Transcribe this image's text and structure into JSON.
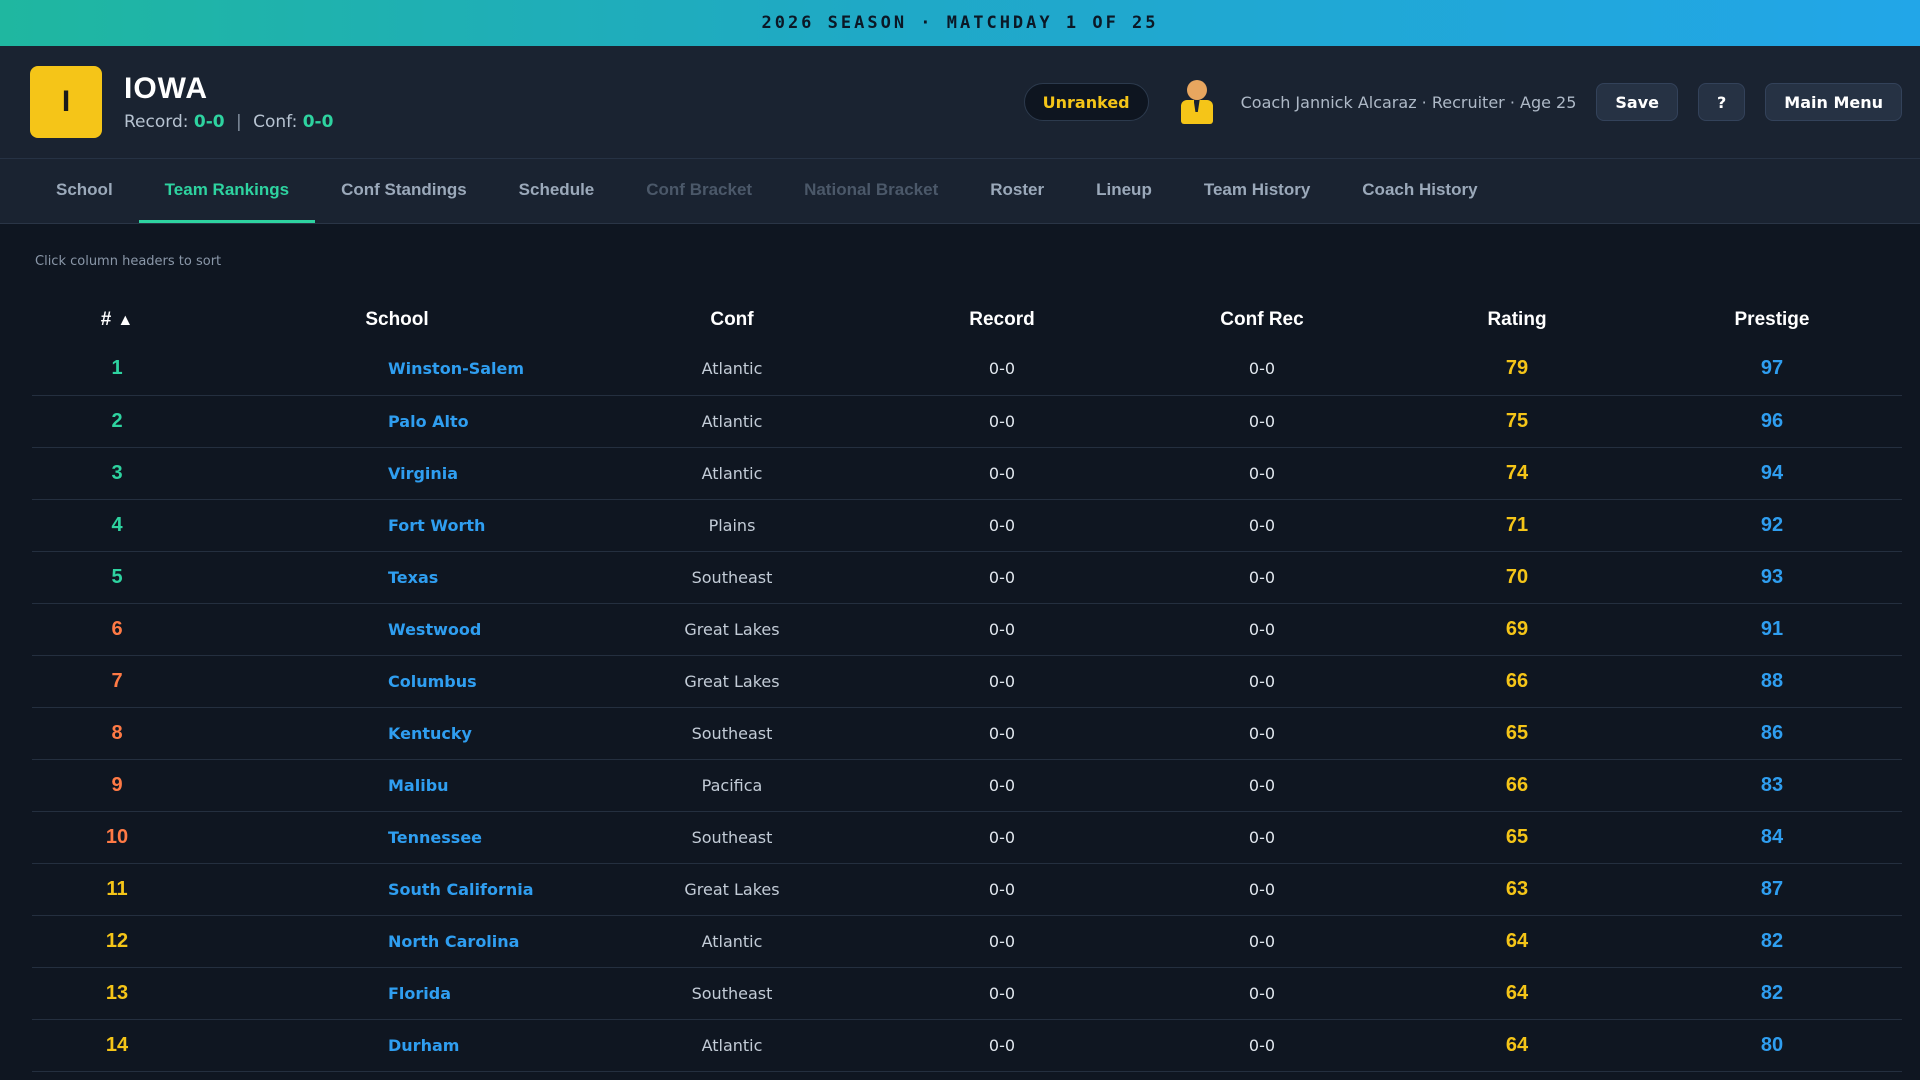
{
  "season_banner": "2026 SEASON · MATCHDAY 1 OF 25",
  "team": {
    "logo_letter": "I",
    "name": "IOWA",
    "record_label": "Record:",
    "record": "0-0",
    "separator": "|",
    "conf_label": "Conf:",
    "conf_record": "0-0"
  },
  "rank_badge": "Unranked",
  "coach": {
    "icon": "coach-avatar-icon",
    "text": "Coach Jannick Alcaraz · Recruiter · Age 25"
  },
  "buttons": {
    "save": "Save",
    "help": "?",
    "main_menu": "Main Menu"
  },
  "tabs": [
    {
      "label": "School",
      "state": "normal"
    },
    {
      "label": "Team Rankings",
      "state": "active"
    },
    {
      "label": "Conf Standings",
      "state": "normal"
    },
    {
      "label": "Schedule",
      "state": "normal"
    },
    {
      "label": "Conf Bracket",
      "state": "disabled"
    },
    {
      "label": "National Bracket",
      "state": "disabled"
    },
    {
      "label": "Roster",
      "state": "normal"
    },
    {
      "label": "Lineup",
      "state": "normal"
    },
    {
      "label": "Team History",
      "state": "normal"
    },
    {
      "label": "Coach History",
      "state": "normal"
    }
  ],
  "hint": "Click column headers to sort",
  "table": {
    "headers": {
      "rank": "#",
      "sort_indicator": "▲",
      "school": "School",
      "conf": "Conf",
      "record": "Record",
      "conf_rec": "Conf Rec",
      "rating": "Rating",
      "prestige": "Prestige"
    },
    "rows": [
      {
        "rank": "1",
        "school": "Winston-Salem",
        "conf": "Atlantic",
        "record": "0-0",
        "conf_rec": "0-0",
        "rating": "79",
        "prestige": "97"
      },
      {
        "rank": "2",
        "school": "Palo Alto",
        "conf": "Atlantic",
        "record": "0-0",
        "conf_rec": "0-0",
        "rating": "75",
        "prestige": "96"
      },
      {
        "rank": "3",
        "school": "Virginia",
        "conf": "Atlantic",
        "record": "0-0",
        "conf_rec": "0-0",
        "rating": "74",
        "prestige": "94"
      },
      {
        "rank": "4",
        "school": "Fort Worth",
        "conf": "Plains",
        "record": "0-0",
        "conf_rec": "0-0",
        "rating": "71",
        "prestige": "92"
      },
      {
        "rank": "5",
        "school": "Texas",
        "conf": "Southeast",
        "record": "0-0",
        "conf_rec": "0-0",
        "rating": "70",
        "prestige": "93"
      },
      {
        "rank": "6",
        "school": "Westwood",
        "conf": "Great Lakes",
        "record": "0-0",
        "conf_rec": "0-0",
        "rating": "69",
        "prestige": "91"
      },
      {
        "rank": "7",
        "school": "Columbus",
        "conf": "Great Lakes",
        "record": "0-0",
        "conf_rec": "0-0",
        "rating": "66",
        "prestige": "88"
      },
      {
        "rank": "8",
        "school": "Kentucky",
        "conf": "Southeast",
        "record": "0-0",
        "conf_rec": "0-0",
        "rating": "65",
        "prestige": "86"
      },
      {
        "rank": "9",
        "school": "Malibu",
        "conf": "Pacifica",
        "record": "0-0",
        "conf_rec": "0-0",
        "rating": "66",
        "prestige": "83"
      },
      {
        "rank": "10",
        "school": "Tennessee",
        "conf": "Southeast",
        "record": "0-0",
        "conf_rec": "0-0",
        "rating": "65",
        "prestige": "84"
      },
      {
        "rank": "11",
        "school": "South California",
        "conf": "Great Lakes",
        "record": "0-0",
        "conf_rec": "0-0",
        "rating": "63",
        "prestige": "87"
      },
      {
        "rank": "12",
        "school": "North Carolina",
        "conf": "Atlantic",
        "record": "0-0",
        "conf_rec": "0-0",
        "rating": "64",
        "prestige": "82"
      },
      {
        "rank": "13",
        "school": "Florida",
        "conf": "Southeast",
        "record": "0-0",
        "conf_rec": "0-0",
        "rating": "64",
        "prestige": "82"
      },
      {
        "rank": "14",
        "school": "Durham",
        "conf": "Atlantic",
        "record": "0-0",
        "conf_rec": "0-0",
        "rating": "64",
        "prestige": "80"
      }
    ]
  },
  "colors": {
    "accent_green": "#2ed3a0",
    "rank_top_tier": "#2ed3a0",
    "rank_mid_tier": "#ff7a45",
    "rank_low_tier": "#f5c518",
    "rating": "#f5c518",
    "prestige": "#2f9ef0",
    "link_blue": "#2f9ef0"
  }
}
